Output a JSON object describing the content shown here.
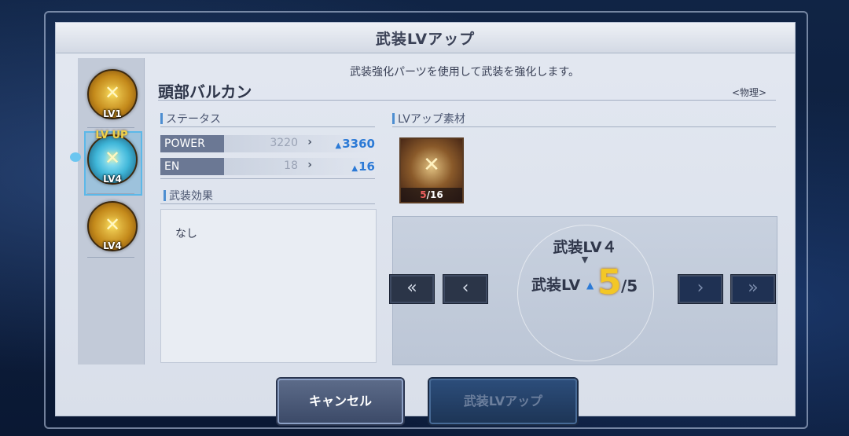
{
  "dialog": {
    "title": "武装LVアップ",
    "description": "武装強化パーツを使用して武装を強化します。",
    "weapon_name": "頭部バルカン",
    "weapon_type": "<物理>"
  },
  "sidebar": {
    "slots": [
      {
        "label": "LV1",
        "icon": "weapon-emblem-icon"
      },
      {
        "label": "LV4",
        "badge": "LV UP",
        "icon": "weapon-emblem-icon",
        "active": true
      },
      {
        "label": "LV4",
        "icon": "weapon-emblem-icon"
      }
    ]
  },
  "status": {
    "heading": "ステータス",
    "rows": [
      {
        "name": "POWER",
        "old": "3220",
        "new": "3360"
      },
      {
        "name": "EN",
        "old": "18",
        "new": "16"
      }
    ]
  },
  "effect": {
    "heading": "武装効果",
    "text": "なし"
  },
  "materials": {
    "heading": "LVアップ素材",
    "item_count": "5",
    "item_total": "/16"
  },
  "level": {
    "current": "武装LV４",
    "next_label": "武装LV",
    "next_value": "5",
    "max": "/5"
  },
  "nav": {
    "first": "«",
    "prev": "‹",
    "next": "›",
    "last": "»"
  },
  "buttons": {
    "cancel": "キャンセル",
    "lvup": "武装LVアップ"
  }
}
